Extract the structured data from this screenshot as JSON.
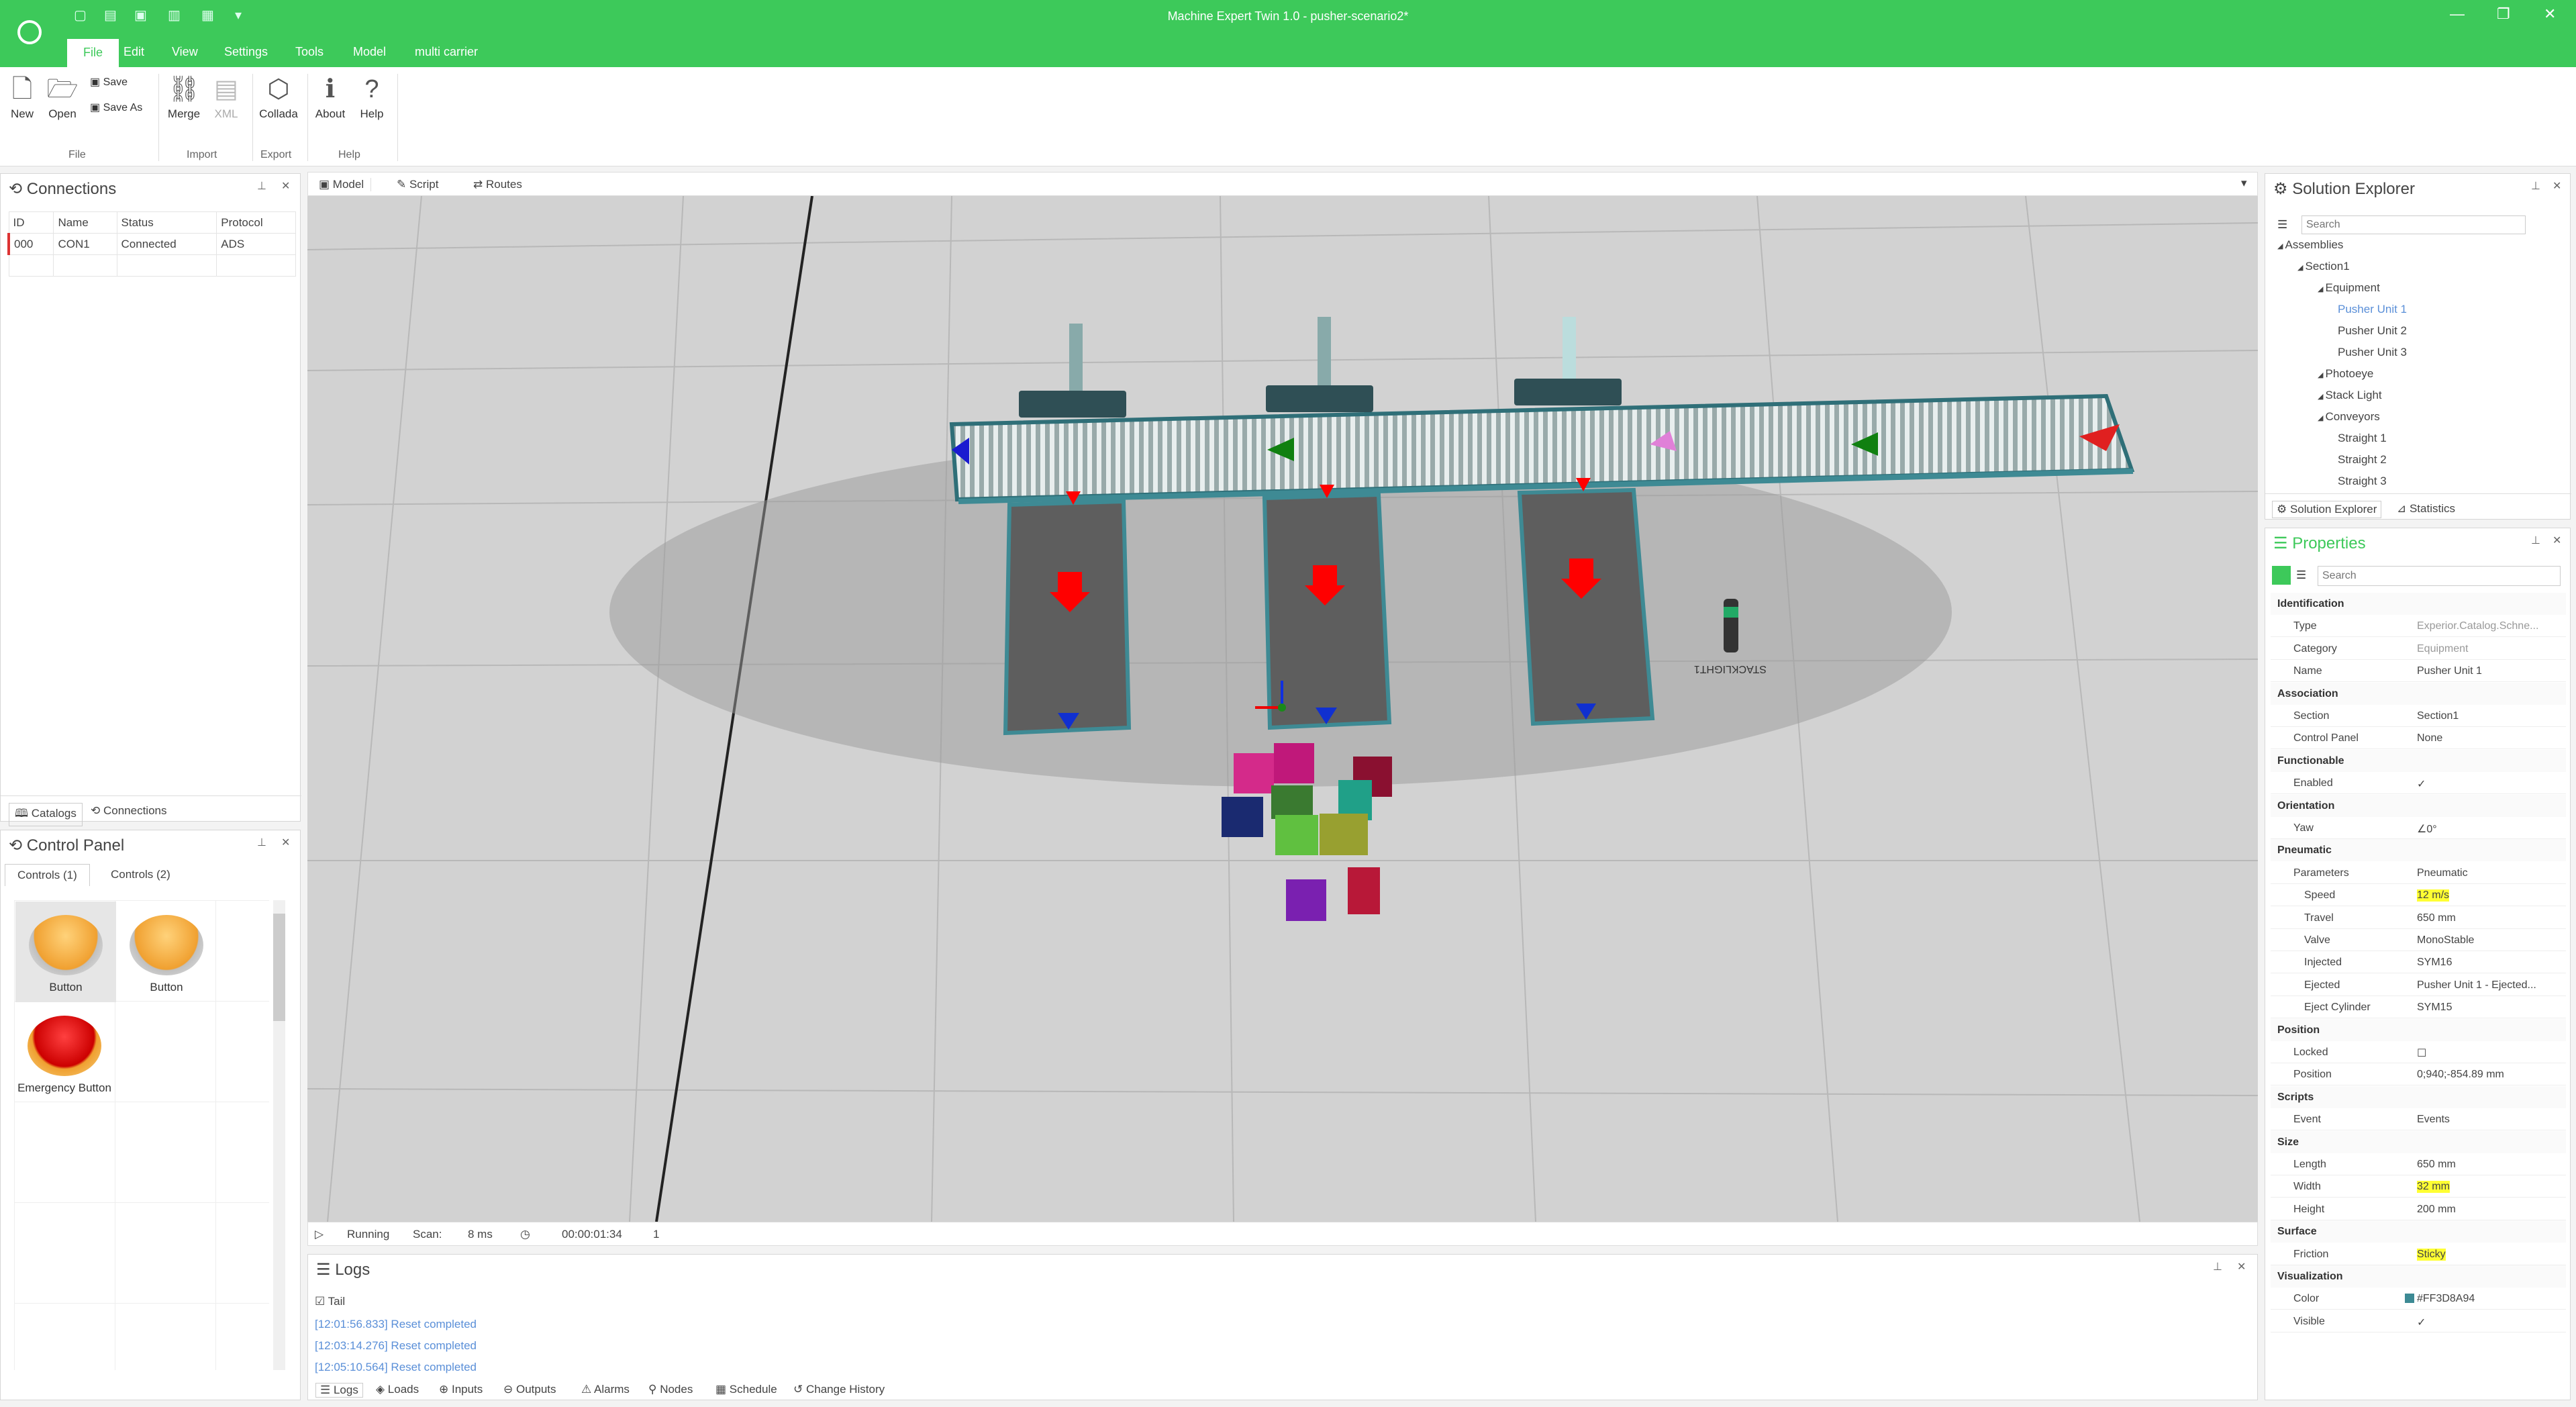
{
  "window": {
    "title": "Machine Expert Twin 1.0 - pusher-scenario2*"
  },
  "menu": [
    "File",
    "Edit",
    "View",
    "Settings",
    "Tools",
    "Model",
    "multi carrier"
  ],
  "ribbon": {
    "new": "New",
    "open": "Open",
    "save": "Save",
    "save_as": "Save As",
    "merge": "Merge",
    "xml": "XML",
    "collada": "Collada",
    "about": "About",
    "help": "Help",
    "groups": {
      "file": "File",
      "import": "Import",
      "export": "Export",
      "help": "Help"
    }
  },
  "connections": {
    "title": "Connections",
    "columns": [
      "ID",
      "Name",
      "Status",
      "Protocol"
    ],
    "rows": [
      [
        "000",
        "CON1",
        "Connected",
        "ADS"
      ]
    ],
    "tabs": [
      "Catalogs",
      "Connections"
    ]
  },
  "control_panel": {
    "title": "Control Panel",
    "tabs": [
      "Controls (1)",
      "Controls (2)"
    ],
    "items": [
      "Button",
      "Button",
      "Emergency Button"
    ]
  },
  "doc_tabs": [
    "Model",
    "Script",
    "Routes"
  ],
  "viewport": {
    "stack_label": "STACKLIGHT1"
  },
  "status": {
    "state": "Running",
    "scan_label": "Scan:",
    "scan_value": "8 ms",
    "time": "00:00:01:34",
    "count": "1"
  },
  "logs": {
    "title": "Logs",
    "tail": "Tail",
    "entries": [
      "[12:01:56.833] Reset completed",
      "[12:03:14.276] Reset completed",
      "[12:05:10.564] Reset completed"
    ],
    "tabs": [
      "Logs",
      "Loads",
      "Inputs",
      "Outputs",
      "Alarms",
      "Nodes",
      "Schedule",
      "Change History"
    ]
  },
  "solution_explorer": {
    "title": "Solution Explorer",
    "search_placeholder": "Search",
    "tree": [
      {
        "label": "Assemblies",
        "level": 0
      },
      {
        "label": "Section1",
        "level": 1
      },
      {
        "label": "Equipment",
        "level": 2
      },
      {
        "label": "Pusher Unit 1",
        "level": 3,
        "selected": true
      },
      {
        "label": "Pusher Unit 2",
        "level": 3
      },
      {
        "label": "Pusher Unit 3",
        "level": 3
      },
      {
        "label": "Photoeye",
        "level": 2
      },
      {
        "label": "Stack Light",
        "level": 2
      },
      {
        "label": "Conveyors",
        "level": 2
      },
      {
        "label": "Straight 1",
        "level": 3
      },
      {
        "label": "Straight 2",
        "level": 3
      },
      {
        "label": "Straight 3",
        "level": 3
      }
    ],
    "tabs": [
      "Solution Explorer",
      "Statistics"
    ]
  },
  "properties": {
    "title": "Properties",
    "search_placeholder": "Search",
    "rows": [
      {
        "cat": "Identification"
      },
      {
        "k": "Type",
        "v": "Experior.Catalog.Schne..."
      },
      {
        "k": "Category",
        "v": "Equipment"
      },
      {
        "k": "Name",
        "v": "Pusher Unit 1"
      },
      {
        "cat": "Association"
      },
      {
        "k": "Section",
        "v": "Section1"
      },
      {
        "k": "Control Panel",
        "v": "None"
      },
      {
        "cat": "Functionable"
      },
      {
        "k": "Enabled",
        "v": "✓"
      },
      {
        "cat": "Orientation"
      },
      {
        "k": "Yaw",
        "v": "∠0°"
      },
      {
        "cat": "Pneumatic"
      },
      {
        "k": "Parameters",
        "v": "Pneumatic"
      },
      {
        "k": "Speed",
        "v": "12 m/s",
        "hl": true,
        "indent": true
      },
      {
        "k": "Travel",
        "v": "650 mm",
        "indent": true
      },
      {
        "k": "Valve",
        "v": "MonoStable",
        "indent": true
      },
      {
        "k": "Injected",
        "v": "SYM16",
        "indent": true
      },
      {
        "k": "Ejected",
        "v": "Pusher Unit 1 - Ejected...",
        "indent": true
      },
      {
        "k": "Eject Cylinder",
        "v": "SYM15",
        "indent": true
      },
      {
        "cat": "Position"
      },
      {
        "k": "Locked",
        "v": "☐"
      },
      {
        "k": "Position",
        "v": "0;940;-854.89 mm"
      },
      {
        "cat": "Scripts"
      },
      {
        "k": "Event",
        "v": "Events"
      },
      {
        "cat": "Size"
      },
      {
        "k": "Length",
        "v": "650 mm"
      },
      {
        "k": "Width",
        "v": "32 mm",
        "hl": true
      },
      {
        "k": "Height",
        "v": "200 mm"
      },
      {
        "cat": "Surface"
      },
      {
        "k": "Friction",
        "v": "Sticky",
        "hl": true
      },
      {
        "cat": "Visualization"
      },
      {
        "k": "Color",
        "v": "#FF3D8A94"
      },
      {
        "k": "Visible",
        "v": "✓"
      }
    ]
  },
  "colors": {
    "accent": "#3dc95a",
    "swatch": "#3d8a94"
  }
}
